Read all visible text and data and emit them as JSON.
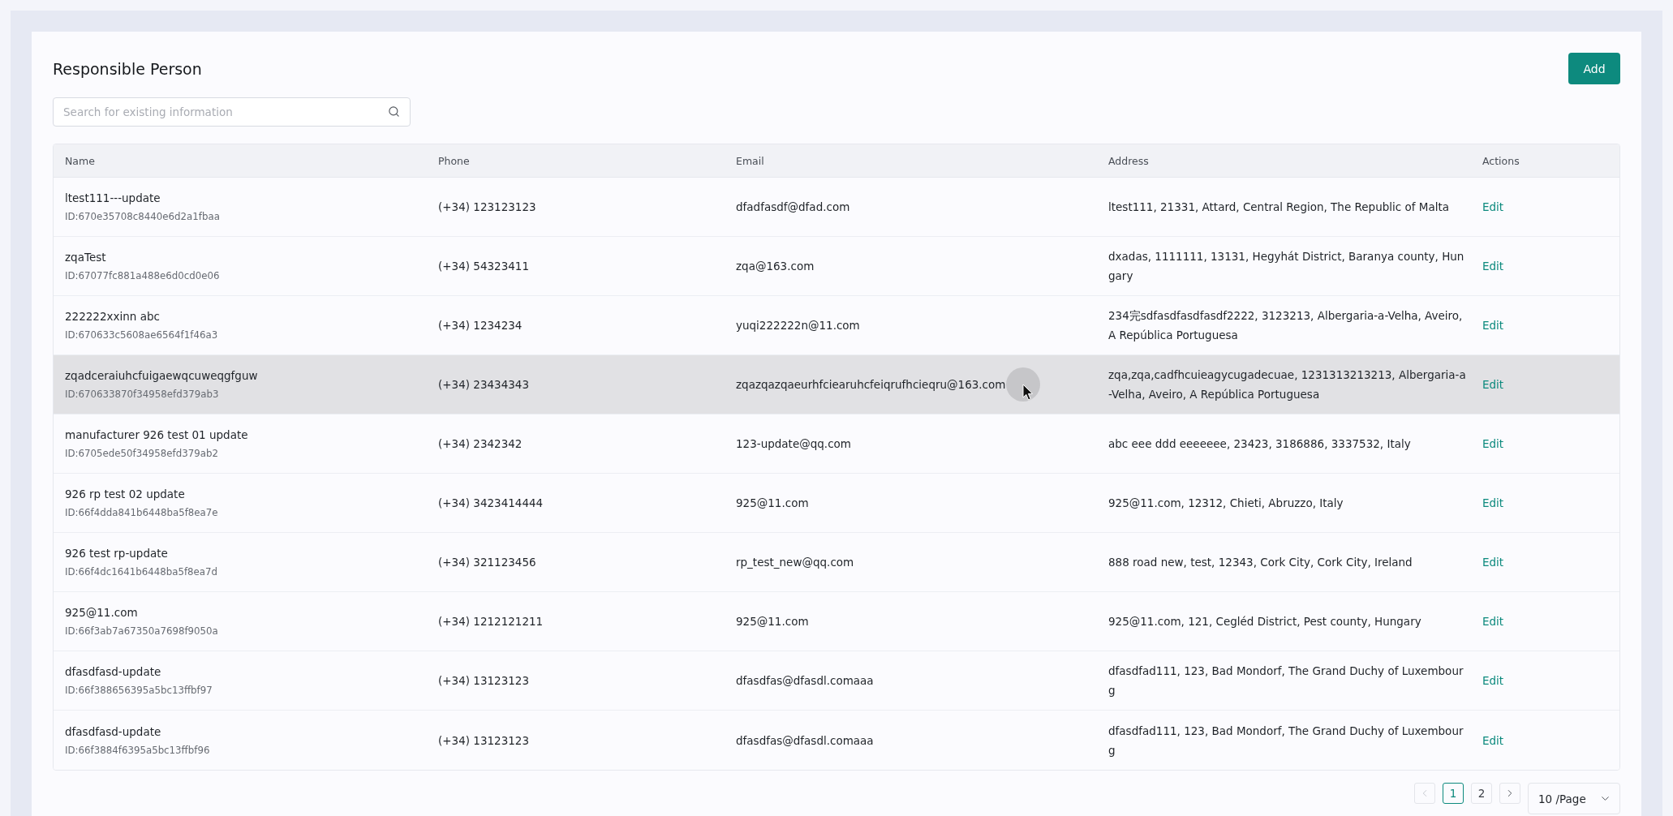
{
  "page": {
    "title": "Responsible Person",
    "add_button": "Add"
  },
  "search": {
    "placeholder": "Search for existing information"
  },
  "table": {
    "columns": [
      "Name",
      "Phone",
      "Email",
      "Address",
      "Actions"
    ],
    "rows": [
      {
        "name": "ltest111---update",
        "id": "ID:670e35708c8440e6d2a1fbaa",
        "phone": "(+34) 123123123",
        "email": "dfadfasdf@dfad.com",
        "address": "ltest111, 21331, Attard, Central Region, The Republic of Malta",
        "action": "Edit",
        "hovered": false
      },
      {
        "name": "zqaTest",
        "id": "ID:67077fc881a488e6d0cd0e06",
        "phone": "(+34) 54323411",
        "email": "zqa@163.com",
        "address": "dxadas, 1111111, 13131, Hegyhát District, Baranya county, Hungary",
        "action": "Edit",
        "hovered": false
      },
      {
        "name": "222222xxinn abc",
        "id": "ID:670633c5608ae6564f1f46a3",
        "phone": "(+34) 1234234",
        "email": "yuqi222222n@11.com",
        "address": "234完sdfasdfasdfasdf2222, 3123213, Albergaria-a-Velha, Aveiro, A República Portuguesa",
        "action": "Edit",
        "hovered": false
      },
      {
        "name": "zqadceraiuhcfuigaewqcuweqgfguw",
        "id": "ID:670633870f34958efd379ab3",
        "phone": "(+34) 23434343",
        "email": "zqazqazqaeurhfciearuhcfeiqrufhcieqru@163.com",
        "address": "zqa,zqa,cadfhcuieagycugadecuae, 1231313213213, Albergaria-a-Velha, Aveiro, A República Portuguesa",
        "action": "Edit",
        "hovered": true
      },
      {
        "name": "manufacturer 926 test 01 update",
        "id": "ID:6705ede50f34958efd379ab2",
        "phone": "(+34) 2342342",
        "email": "123-update@qq.com",
        "address": "abc eee ddd eeeeeee, 23423, 3186886, 3337532, Italy",
        "action": "Edit",
        "hovered": false
      },
      {
        "name": "926 rp test 02 update",
        "id": "ID:66f4dda841b6448ba5f8ea7e",
        "phone": "(+34) 3423414444",
        "email": "925@11.com",
        "address": "925@11.com, 12312, Chieti, Abruzzo, Italy",
        "action": "Edit",
        "hovered": false
      },
      {
        "name": "926 test rp-update",
        "id": "ID:66f4dc1641b6448ba5f8ea7d",
        "phone": "(+34) 321123456",
        "email": "rp_test_new@qq.com",
        "address": "888 road new, test, 12343, Cork City, Cork City, Ireland",
        "action": "Edit",
        "hovered": false
      },
      {
        "name": "925@11.com",
        "id": "ID:66f3ab7a67350a7698f9050a",
        "phone": "(+34) 1212121211",
        "email": "925@11.com",
        "address": "925@11.com, 121, Cegléd District, Pest county, Hungary",
        "action": "Edit",
        "hovered": false
      },
      {
        "name": "dfasdfasd-update",
        "id": "ID:66f388656395a5bc13ffbf97",
        "phone": "(+34) 13123123",
        "email": "dfasdfas@dfasdl.comaaa",
        "address": "dfasdfad111, 123, Bad Mondorf, The Grand Duchy of Luxembourg",
        "action": "Edit",
        "hovered": false
      },
      {
        "name": "dfasdfasd-update",
        "id": "ID:66f3884f6395a5bc13ffbf96",
        "phone": "(+34) 13123123",
        "email": "dfasdfas@dfasdl.comaaa",
        "address": "dfasdfad111, 123, Bad Mondorf, The Grand Duchy of Luxembourg",
        "action": "Edit",
        "hovered": false
      }
    ]
  },
  "pagination": {
    "prev": {
      "disabled": true
    },
    "pages": [
      {
        "label": "1",
        "selected": true
      },
      {
        "label": "2",
        "selected": false
      }
    ],
    "next": {
      "disabled": false
    },
    "page_size": "10 /Page"
  }
}
